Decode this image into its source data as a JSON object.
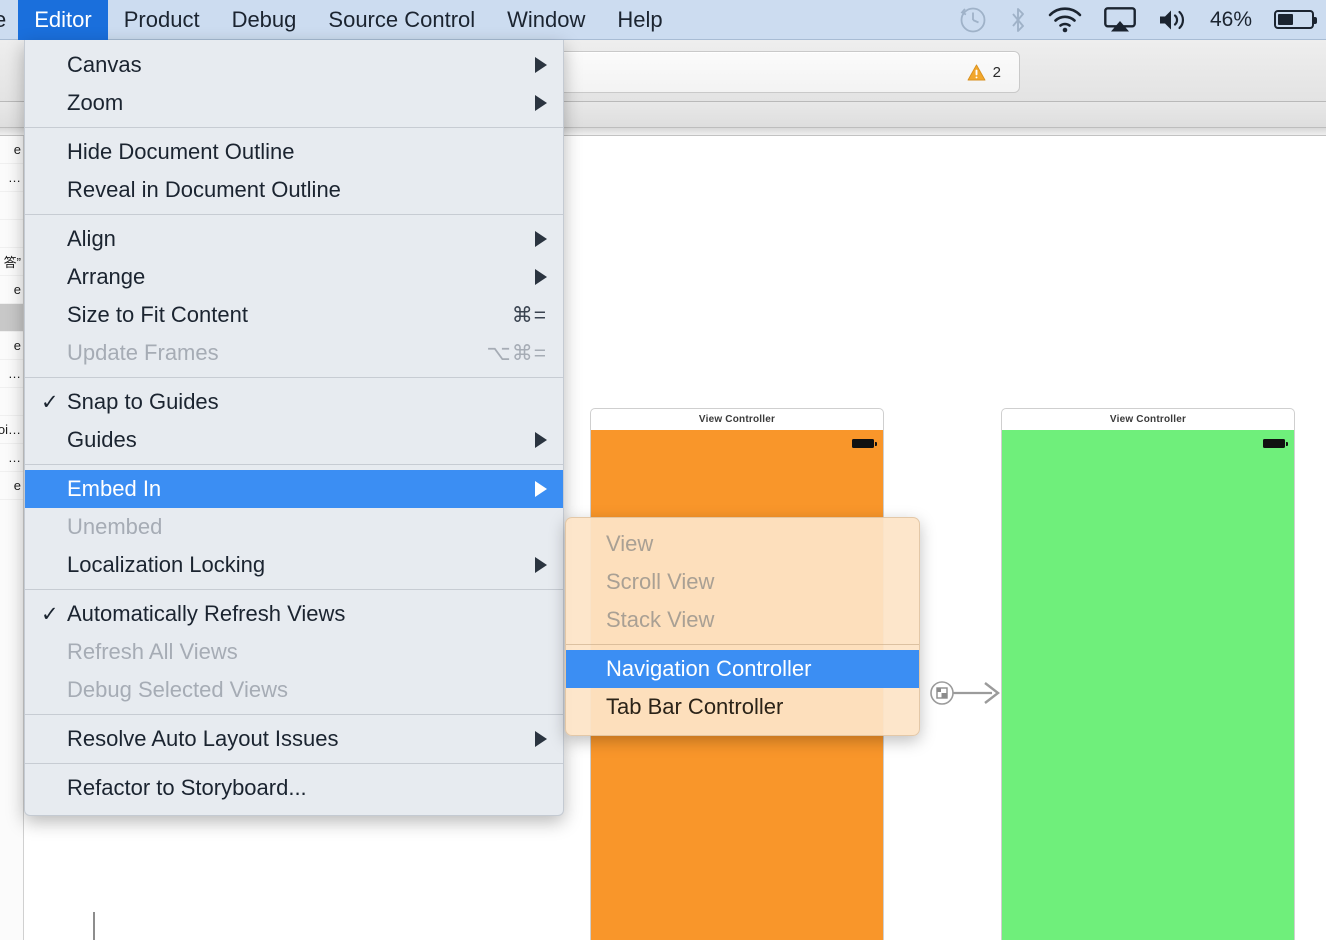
{
  "menubar": {
    "clipped_item": "e",
    "items": [
      {
        "label": "Editor",
        "active": true
      },
      {
        "label": "Product",
        "active": false
      },
      {
        "label": "Debug",
        "active": false
      },
      {
        "label": "Source Control",
        "active": false
      },
      {
        "label": "Window",
        "active": false
      },
      {
        "label": "Help",
        "active": false
      }
    ],
    "status": {
      "time_machine_icon": "time-machine-icon",
      "bluetooth_icon": "bluetooth-icon",
      "wifi_icon": "wifi-icon",
      "airplay_icon": "airplay-icon",
      "volume_icon": "volume-icon",
      "battery_percent": "46%",
      "battery_level": 46
    }
  },
  "editor_menu": {
    "groups": [
      {
        "items": [
          {
            "label": "Canvas",
            "submenu": true,
            "disabled": false,
            "checked": false,
            "shortcut": ""
          },
          {
            "label": "Zoom",
            "submenu": true,
            "disabled": false,
            "checked": false,
            "shortcut": ""
          }
        ]
      },
      {
        "items": [
          {
            "label": "Hide Document Outline",
            "submenu": false,
            "disabled": false,
            "checked": false,
            "shortcut": ""
          },
          {
            "label": "Reveal in Document Outline",
            "submenu": false,
            "disabled": false,
            "checked": false,
            "shortcut": ""
          }
        ]
      },
      {
        "items": [
          {
            "label": "Align",
            "submenu": true,
            "disabled": false,
            "checked": false,
            "shortcut": ""
          },
          {
            "label": "Arrange",
            "submenu": true,
            "disabled": false,
            "checked": false,
            "shortcut": ""
          },
          {
            "label": "Size to Fit Content",
            "submenu": false,
            "disabled": false,
            "checked": false,
            "shortcut": "⌘="
          },
          {
            "label": "Update Frames",
            "submenu": false,
            "disabled": true,
            "checked": false,
            "shortcut": "⌥⌘="
          }
        ]
      },
      {
        "items": [
          {
            "label": "Snap to Guides",
            "submenu": false,
            "disabled": false,
            "checked": true,
            "shortcut": ""
          },
          {
            "label": "Guides",
            "submenu": true,
            "disabled": false,
            "checked": false,
            "shortcut": ""
          }
        ]
      },
      {
        "items": [
          {
            "label": "Embed In",
            "submenu": true,
            "disabled": false,
            "checked": false,
            "highlighted": true,
            "shortcut": ""
          },
          {
            "label": "Unembed",
            "submenu": false,
            "disabled": true,
            "checked": false,
            "shortcut": ""
          },
          {
            "label": "Localization Locking",
            "submenu": true,
            "disabled": false,
            "checked": false,
            "shortcut": ""
          }
        ]
      },
      {
        "items": [
          {
            "label": "Automatically Refresh Views",
            "submenu": false,
            "disabled": false,
            "checked": true,
            "shortcut": ""
          },
          {
            "label": "Refresh All Views",
            "submenu": false,
            "disabled": true,
            "checked": false,
            "shortcut": ""
          },
          {
            "label": "Debug Selected Views",
            "submenu": false,
            "disabled": true,
            "checked": false,
            "shortcut": ""
          }
        ]
      },
      {
        "items": [
          {
            "label": "Resolve Auto Layout Issues",
            "submenu": true,
            "disabled": false,
            "checked": false,
            "shortcut": ""
          }
        ]
      },
      {
        "items": [
          {
            "label": "Refactor to Storyboard...",
            "submenu": false,
            "disabled": false,
            "checked": false,
            "shortcut": ""
          }
        ]
      }
    ]
  },
  "embed_in_submenu": {
    "groups": [
      {
        "items": [
          {
            "label": "View",
            "disabled": true,
            "highlighted": false
          },
          {
            "label": "Scroll View",
            "disabled": true,
            "highlighted": false
          },
          {
            "label": "Stack View",
            "disabled": true,
            "highlighted": false
          }
        ]
      },
      {
        "items": [
          {
            "label": "Navigation Controller",
            "disabled": false,
            "highlighted": true
          },
          {
            "label": "Tab Bar Controller",
            "disabled": false,
            "highlighted": false
          }
        ]
      }
    ]
  },
  "editor_window": {
    "activity_bar": {
      "warning_icon": "warning-triangle-icon",
      "warning_count": "2"
    },
    "scenes": [
      {
        "title": "View Controller",
        "color": "#F9962A",
        "name": "orange-scene"
      },
      {
        "title": "View Controller",
        "color": "#6FEF7B",
        "name": "green-scene"
      }
    ],
    "segue_icon": "segue-arrow-icon"
  },
  "navigator": {
    "rows": [
      "e",
      "…",
      "",
      "",
      "答”",
      "e",
      "",
      "e",
      "…",
      "",
      "oi…",
      "…",
      "e"
    ]
  },
  "colors": {
    "menubar_bg": "#CCDCF0",
    "menubar_highlight": "#1A6FDC",
    "menu_bg": "#E7EBF0",
    "menu_highlight": "#3B8EF3",
    "submenu_bg": "#FDE4C7",
    "orange_scene": "#F9962A",
    "green_scene": "#6FEF7B",
    "warning_amber": "#F2A72C"
  }
}
